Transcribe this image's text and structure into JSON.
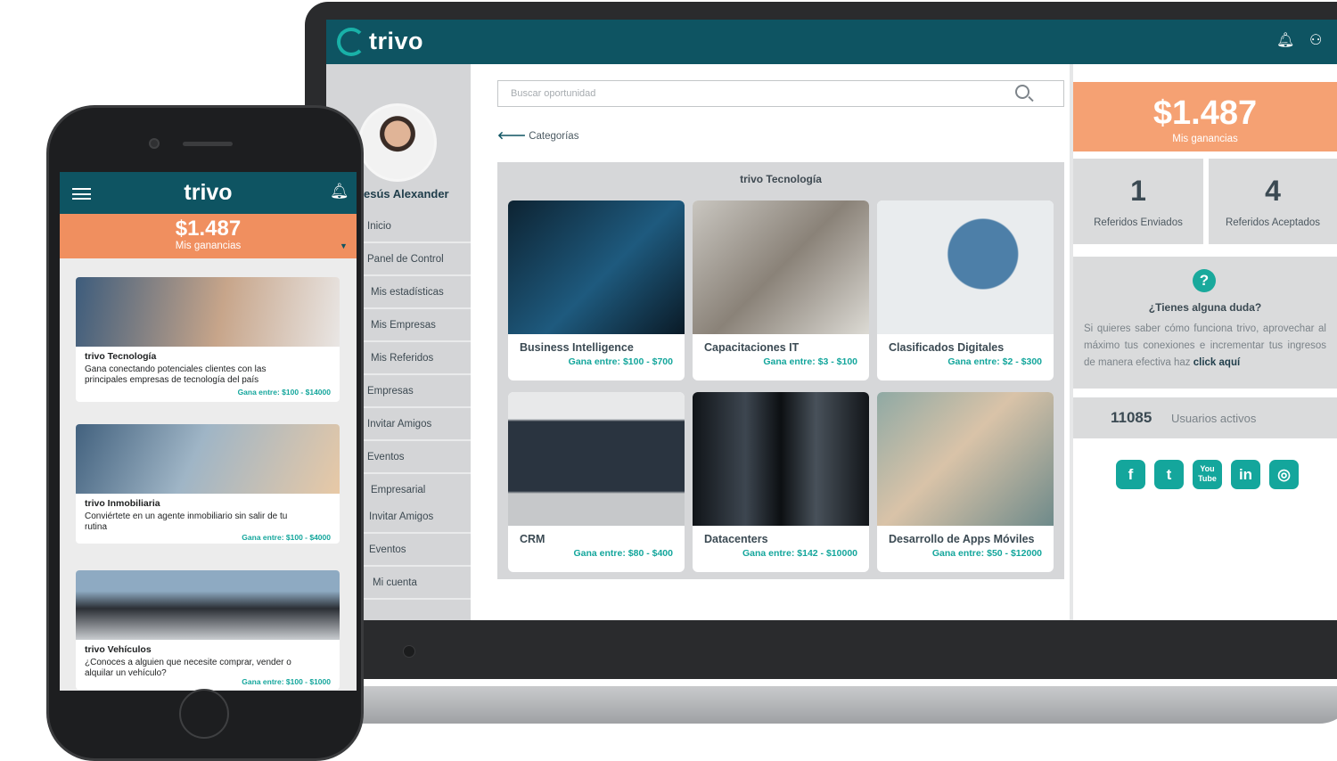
{
  "app": {
    "logo": "trivo"
  },
  "laptop": {
    "sidebar": {
      "user_name": "esús Alexander",
      "menu": [
        "Inicio",
        "Panel de Control",
        "Mis estadísticas",
        "Mis Empresas",
        "Mis Referidos",
        "Empresas",
        "Invitar Amigos",
        "Eventos",
        "Empresarial",
        "Invitar Amigos",
        "Eventos",
        "Mi cuenta"
      ]
    },
    "search": {
      "placeholder": "Buscar oportunidad"
    },
    "breadcrumb": "Categorías",
    "section_title": "trivo Tecnología",
    "earn_prefix": "Gana entre:",
    "cards": [
      {
        "name": "Business Intelligence",
        "range": "$100 - $700"
      },
      {
        "name": "Capacitaciones IT",
        "range": "$3 - $100"
      },
      {
        "name": "Clasificados Digitales",
        "range": "$2 - $300"
      },
      {
        "name": "CRM",
        "range": "$80 - $400"
      },
      {
        "name": "Datacenters",
        "range": "$142 - $10000"
      },
      {
        "name": "Desarrollo de Apps Móviles",
        "range": "$50 - $12000"
      }
    ],
    "earnings": {
      "amount": "$1.487",
      "label": "Mis ganancias"
    },
    "stats": [
      {
        "value": "1",
        "label": "Referidos Enviados"
      },
      {
        "value": "4",
        "label": "Referidos Aceptados"
      }
    ],
    "help": {
      "title": "¿Tienes alguna duda?",
      "text": "Si quieres saber cómo funciona trivo, aprovechar al máximo tus conexiones e incrementar tus ingresos de manera efectiva haz",
      "link": "click aquí"
    },
    "active_users": {
      "count": "11085",
      "label": "Usuarios activos"
    },
    "socials": [
      "f",
      "t",
      "You Tube",
      "in",
      "◎"
    ]
  },
  "phone": {
    "logo": "trivo",
    "earnings": {
      "amount": "$1.487",
      "label": "Mis ganancias"
    },
    "cards": [
      {
        "title": "trivo Tecnología",
        "desc": "Gana  conectando potenciales clientes con las principales empresas de tecnología del país",
        "earn": "Gana entre: $100 - $14000"
      },
      {
        "title": "trivo Inmobiliaria",
        "desc": "Conviértete en un agente inmobiliario sin salir de tu rutina",
        "earn": "Gana entre: $100 - $4000"
      },
      {
        "title": "trivo Vehículos",
        "desc": "¿Conoces a alguien que necesite comprar, vender o alquilar un vehículo?",
        "earn": "Gana entre: $100 - $1000"
      }
    ]
  },
  "colors": {
    "primary": "#0e5462",
    "accent_teal": "#14a69c",
    "earnings_orange": "#f5a173"
  }
}
